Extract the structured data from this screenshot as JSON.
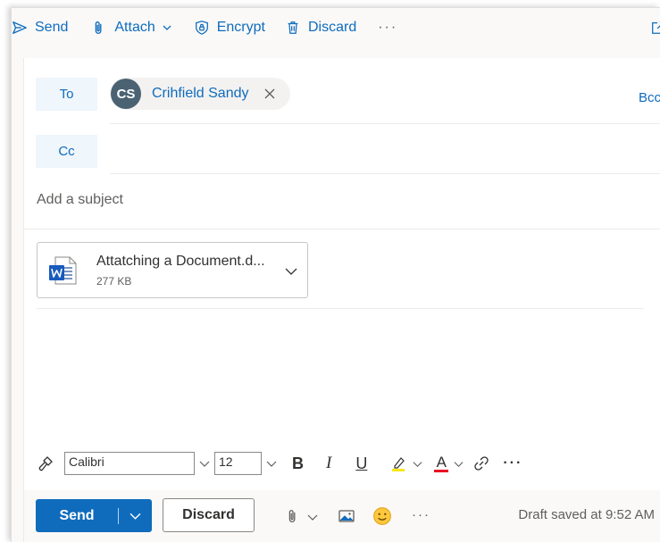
{
  "toolbar": {
    "send_label": "Send",
    "attach_label": "Attach",
    "encrypt_label": "Encrypt",
    "discard_label": "Discard",
    "more_label": "···"
  },
  "recipients": {
    "to_label": "To",
    "cc_label": "Cc",
    "bcc_label": "Bcc",
    "to": [
      {
        "initials": "CS",
        "name": "Crihfield Sandy"
      }
    ]
  },
  "subject": {
    "placeholder": "Add a subject"
  },
  "attachment": {
    "name": "Attatching a Document.d...",
    "size": "277 KB"
  },
  "format": {
    "font": "Calibri",
    "size": "12",
    "bold": "B",
    "italic": "I",
    "underline": "U",
    "font_color_letter": "A",
    "more_label": "···",
    "highlight_color": "#f8e71c",
    "font_color": "#e81123"
  },
  "actions": {
    "send_label": "Send",
    "discard_label": "Discard",
    "more_label": "···",
    "draft_status": "Draft saved at 9:52 AM"
  },
  "colors": {
    "accent": "#0f6cbd",
    "avatar": "#4a6272"
  }
}
